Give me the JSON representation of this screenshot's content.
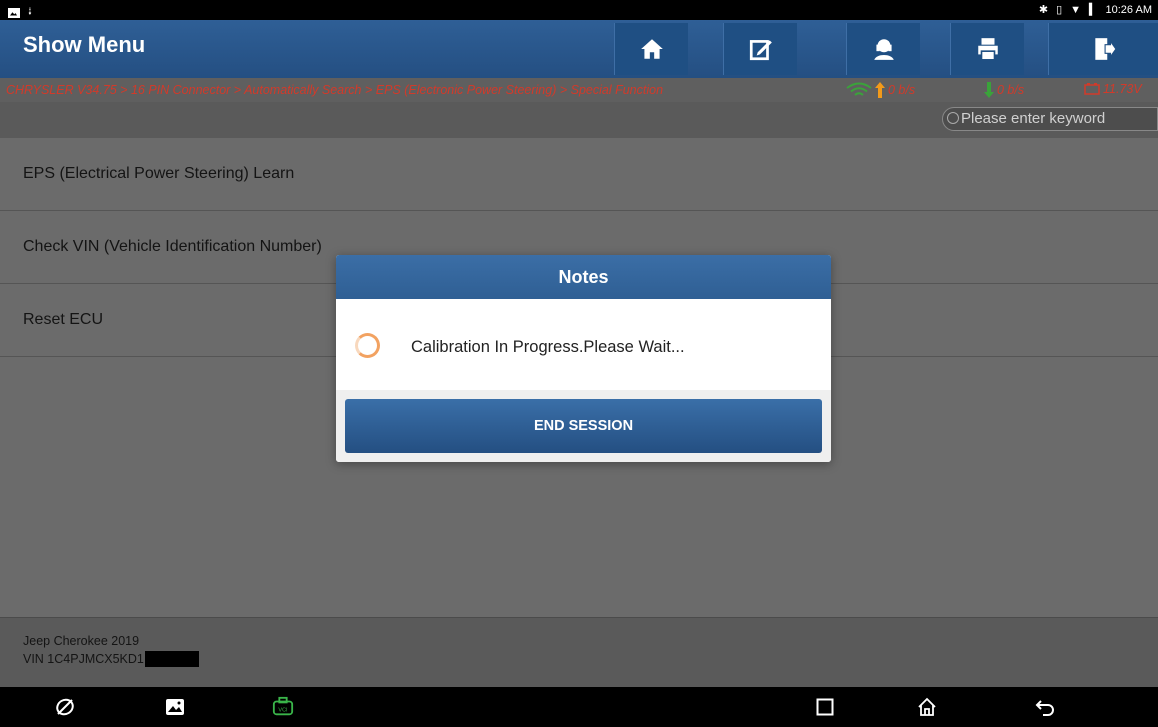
{
  "statusbar": {
    "time": "10:26 AM"
  },
  "header": {
    "title": "Show Menu",
    "buttons": [
      "home-icon",
      "report-icon",
      "remote-support-icon",
      "print-icon",
      "exit-icon"
    ]
  },
  "breadcrumb": {
    "path": "CHRYSLER V34.75 > 16 PIN Connector > Automatically Search > EPS (Electronic Power Steering) > Special Function",
    "upload": "0 b/s",
    "download": "0 b/s",
    "voltage": "11.73V"
  },
  "search": {
    "placeholder": "Please enter keyword"
  },
  "menu": {
    "items": [
      {
        "label": "EPS (Electrical Power Steering) Learn"
      },
      {
        "label": "Check VIN (Vehicle Identification Number)"
      },
      {
        "label": "Reset ECU"
      }
    ]
  },
  "footer": {
    "vehicle": "Jeep Cherokee 2019",
    "vin": "VIN 1C4PJMCX5KD1"
  },
  "dialog": {
    "title": "Notes",
    "message": "Calibration In Progress.Please Wait...",
    "button": "END SESSION"
  },
  "colors": {
    "header_blue": "#2f5f96",
    "breadcrumb_red": "#d23a2a",
    "spinner_orange": "#f2a261",
    "upload_orange": "#f29a1a",
    "download_green": "#3aa33a"
  }
}
